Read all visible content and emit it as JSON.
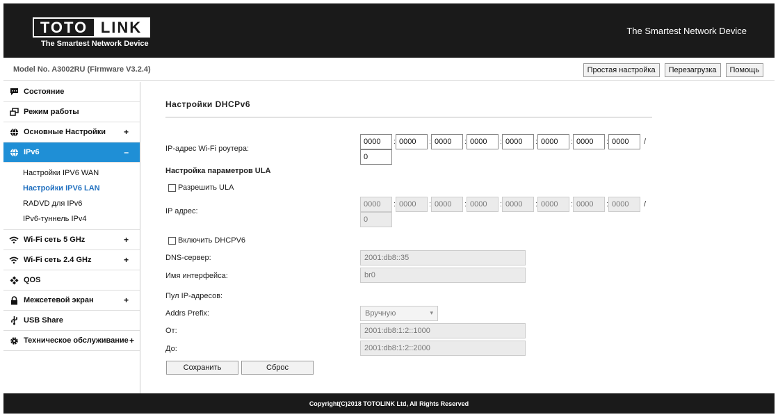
{
  "header": {
    "logo_left": "TOTO",
    "logo_right": "LINK",
    "logo_sub": "The Smartest Network Device",
    "tagline": "The Smartest Network Device"
  },
  "modelbar": {
    "model": "Model No. A3002RU (Firmware V3.2.4)",
    "buttons": [
      "Простая настройка",
      "Перезагрузка",
      "Помощь"
    ]
  },
  "sidebar": {
    "items": [
      {
        "label": "Состояние",
        "icon": "chat-icon",
        "plus": ""
      },
      {
        "label": "Режим работы",
        "icon": "windows-icon",
        "plus": ""
      },
      {
        "label": "Основные Настройки",
        "icon": "globe-icon",
        "plus": "+"
      },
      {
        "label": "IPv6",
        "icon": "globe-icon",
        "plus": "–"
      },
      {
        "label": "Wi-Fi сеть 5 GHz",
        "icon": "wifi-icon",
        "plus": "+"
      },
      {
        "label": "Wi-Fi сеть 2.4 GHz",
        "icon": "wifi-icon",
        "plus": "+"
      },
      {
        "label": "QOS",
        "icon": "qos-icon",
        "plus": ""
      },
      {
        "label": "Межсетевой экран",
        "icon": "lock-icon",
        "plus": "+"
      },
      {
        "label": "USB Share",
        "icon": "usb-icon",
        "plus": ""
      },
      {
        "label": "Техническое обслуживание",
        "icon": "gear-icon",
        "plus": "+"
      }
    ],
    "ipv6_sub": [
      "Настройки IPV6 WAN",
      "Настройки IPV6 LAN",
      "RADVD для IPv6",
      "IPv6-туннель IPv4"
    ],
    "accent": "#1f8fd6"
  },
  "main": {
    "title": "Настройки DHCPv6",
    "router_ip_label": "IP-адрес Wi-Fi роутера:",
    "router_ip": [
      "0000",
      "0000",
      "0000",
      "0000",
      "0000",
      "0000",
      "0000",
      "0000"
    ],
    "router_prefix": "0",
    "ula_section": "Настройка параметров ULA",
    "ula_enable": "Разрешить ULA",
    "ip_label": "IP адрес:",
    "ula_ip": [
      "0000",
      "0000",
      "0000",
      "0000",
      "0000",
      "0000",
      "0000",
      "0000"
    ],
    "ula_prefix": "0",
    "dhcp_enable": "Включить DHCPV6",
    "dns_label": "DNS-сервер:",
    "dns_value": "2001:db8::35",
    "iface_label": "Имя интерфейса:",
    "iface_value": "br0",
    "pool_label": "Пул IP-адресов:",
    "prefix_label": "Addrs Prefix:",
    "prefix_value": "Вручную",
    "from_label": "От:",
    "from_value": "2001:db8:1:2::1000",
    "to_label": "До:",
    "to_value": "2001:db8:1:2::2000",
    "save": "Сохранить",
    "reset": "Сброс"
  },
  "footer": {
    "copyright": "Copyright(C)2018 TOTOLINK Ltd, All Rights Reserved"
  }
}
